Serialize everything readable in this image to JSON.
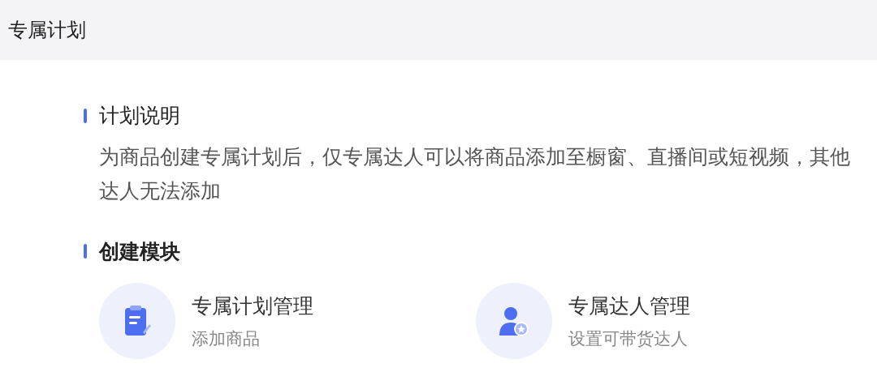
{
  "header": {
    "title": "专属计划"
  },
  "sections": [
    {
      "title": "计划说明",
      "body": "为商品创建专属计划后，仅专属达人可以将商品添加至橱窗、直播间或短视频，其他达人无法添加"
    },
    {
      "title": "创建模块",
      "modules": [
        {
          "kind": "plan",
          "title": "专属计划管理",
          "subtitle": "添加商品"
        },
        {
          "kind": "creator",
          "title": "专属达人管理",
          "subtitle": "设置可带货达人"
        }
      ]
    }
  ]
}
